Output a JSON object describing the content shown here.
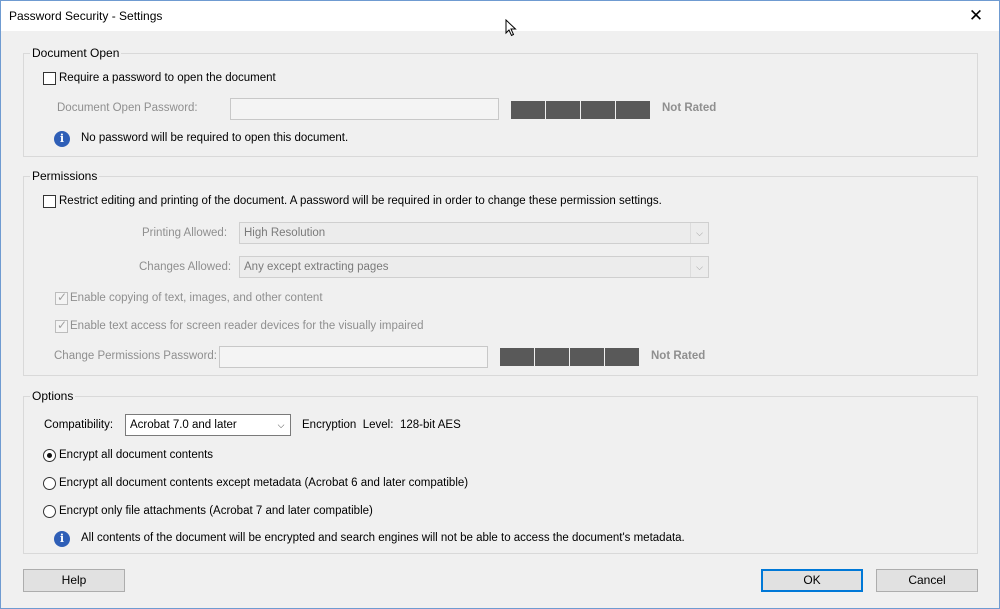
{
  "window": {
    "title": "Password Security - Settings",
    "close_glyph": "✕"
  },
  "document_open": {
    "legend": "Document Open",
    "require_password_label": "Require a password to open the document",
    "password_label": "Document Open Password:",
    "password_value": "",
    "rating": "Not Rated",
    "info": "No password will be required to open this document."
  },
  "permissions": {
    "legend": "Permissions",
    "restrict_label": "Restrict editing and printing of the document. A password will be required in order to change these permission settings.",
    "printing_label": "Printing Allowed:",
    "printing_value": "High Resolution",
    "changes_label": "Changes Allowed:",
    "changes_value": "Any except extracting pages",
    "copying_label": "Enable copying of text, images, and other content",
    "screen_reader_label": "Enable text access for screen reader devices for the visually impaired",
    "password_label": "Change Permissions Password:",
    "password_value": "",
    "rating": "Not Rated"
  },
  "options": {
    "legend": "Options",
    "compat_label": "Compatibility:",
    "compat_value": "Acrobat 7.0 and later",
    "encryption_label": "Encryption  Level:",
    "encryption_value": "128-bit AES",
    "radio_all": "Encrypt all document contents",
    "radio_except_meta": "Encrypt all document contents except metadata (Acrobat 6 and later compatible)",
    "radio_attachments": "Encrypt only file attachments (Acrobat 7 and later compatible)",
    "selected": "Encrypt all document contents",
    "info": "All contents of the document will be encrypted and search engines will not be able to access the document's metadata."
  },
  "buttons": {
    "help": "Help",
    "ok": "OK",
    "cancel": "Cancel"
  },
  "icons": {
    "info": "i",
    "dropdown": "⌵"
  },
  "colors": {
    "accent": "#0078d7",
    "info_icon": "#2f5fb7",
    "meter": "#595959"
  }
}
